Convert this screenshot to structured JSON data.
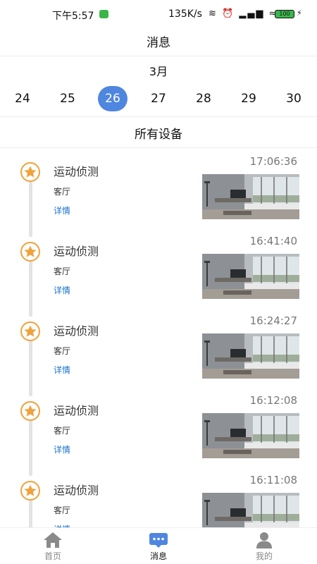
{
  "status_bar": {
    "time": "下午5:57",
    "network_speed": "135K/s",
    "icons": "≋ ⏰ ▂▄▆ ≈",
    "battery": "100",
    "charging": "⚡"
  },
  "header": {
    "title": "消息"
  },
  "calendar": {
    "month": "3月",
    "dates": [
      "24",
      "25",
      "26",
      "27",
      "28",
      "29",
      "30"
    ],
    "selected": "26",
    "accent_color": "#4f86df"
  },
  "filter": {
    "label": "所有设备"
  },
  "events": [
    {
      "title": "运动侦测",
      "room": "客厅",
      "detail": "详情",
      "time": "17:06:36",
      "thumbnail": "living-room-snapshot"
    },
    {
      "title": "运动侦测",
      "room": "客厅",
      "detail": "详情",
      "time": "16:41:40",
      "thumbnail": "living-room-snapshot"
    },
    {
      "title": "运动侦测",
      "room": "客厅",
      "detail": "详情",
      "time": "16:24:27",
      "thumbnail": "living-room-snapshot"
    },
    {
      "title": "运动侦测",
      "room": "客厅",
      "detail": "详情",
      "time": "16:12:08",
      "thumbnail": "living-room-snapshot"
    },
    {
      "title": "运动侦测",
      "room": "客厅",
      "detail": "详情",
      "time": "16:11:08",
      "thumbnail": "living-room-snapshot"
    }
  ],
  "event_icon": "star-icon",
  "tab_bar": {
    "tabs": [
      {
        "label": "首页",
        "icon": "home-icon",
        "active": false
      },
      {
        "label": "消息",
        "icon": "message-icon",
        "active": true
      },
      {
        "label": "我的",
        "icon": "profile-icon",
        "active": false
      }
    ]
  }
}
